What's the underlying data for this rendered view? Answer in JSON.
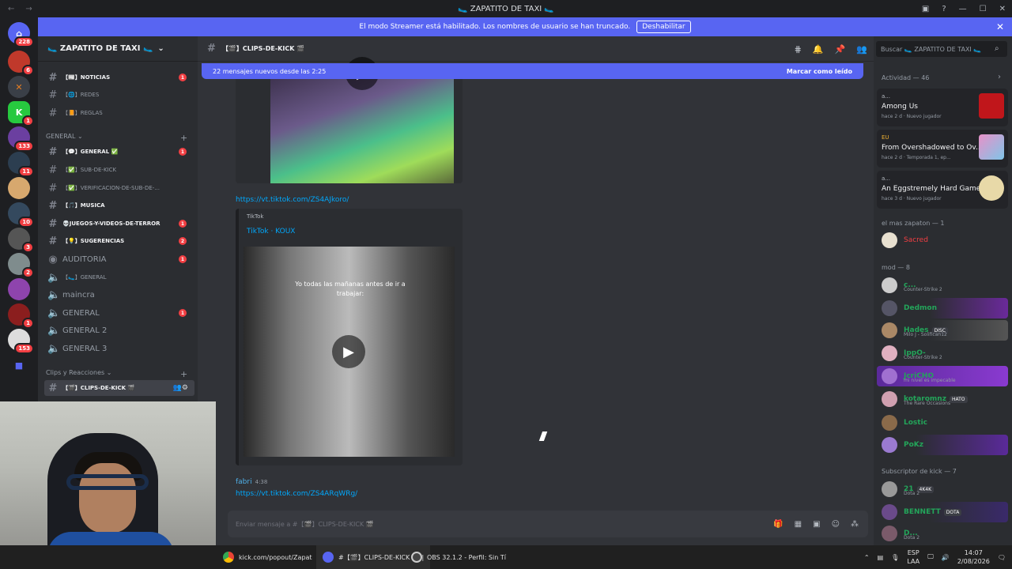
{
  "window": {
    "title": "🥿 ZAPATITO DE TAXI 🥿"
  },
  "banner": {
    "text": "El modo Streamer está habilitado. Los nombres de usuario se han truncado.",
    "button": "Deshabilitar"
  },
  "server": {
    "name": "🥿 ZAPATITO DE TAXI 🥿"
  },
  "channels": [
    {
      "label": "【📰】NOTICIAS",
      "badge": "1",
      "bold": true
    },
    {
      "label": "【🌐】REDES",
      "badge": "",
      "bold": false
    },
    {
      "label": "【📙】REGLAS",
      "badge": "",
      "bold": false
    },
    {
      "label": "【💬】GENERAL ✅",
      "badge": "1",
      "bold": true
    },
    {
      "label": "【✅】SUB-DE-KICK",
      "badge": "",
      "bold": false
    },
    {
      "label": "【✅】VERIFICACION-DE-SUB-DE-...",
      "badge": "",
      "bold": false
    },
    {
      "label": "【🎵】MUSICA",
      "badge": "",
      "bold": true
    },
    {
      "label": "💀JUEGOS-Y-VIDEOS-DE-TERROR",
      "badge": "1",
      "bold": true
    },
    {
      "label": "【💡】SUGERENCIAS",
      "badge": "2",
      "bold": true
    },
    {
      "label": "AUDITORIA",
      "badge": "1",
      "bold": false
    },
    {
      "label": "【🥿】GENERAL",
      "badge": "",
      "bold": false
    },
    {
      "label": "maincra",
      "badge": "",
      "bold": false
    },
    {
      "label": "GENERAL",
      "badge": "1",
      "bold": false
    },
    {
      "label": "GENERAL 2",
      "badge": "",
      "bold": false
    },
    {
      "label": "GENERAL 3",
      "badge": "",
      "bold": false
    },
    {
      "label": "【🎬】CLIPS-DE-KICK 🎬",
      "badge": "",
      "bold": true
    }
  ],
  "categories": {
    "general": "GENERAL",
    "clips": "Clips y Reacciones"
  },
  "server_badges": [
    "228",
    "6",
    "",
    "1",
    "133",
    "11",
    "",
    "10",
    "3",
    "2",
    "",
    "1",
    "153"
  ],
  "chat": {
    "channel_name": "【🎬】CLIPS-DE-KICK 🎬",
    "new_messages": "22 mensajes nuevos desde las 2:25",
    "mark_read": "Marcar como leído",
    "link1": "https://vt.tiktok.com/ZS4AJkoro/",
    "embed_provider": "TikTok",
    "embed_title": "TikTok · KOUX",
    "video_caption": "Yo todas las mañanas antes de ir a trabajar:",
    "author": "fabri",
    "time": "4:38",
    "link2": "https://vt.tiktok.com/ZS4ARqWRg/",
    "placeholder": "Enviar mensaje a #【🎬】CLIPS-DE-KICK 🎬"
  },
  "search": {
    "placeholder": "Buscar 🥿 ZAPATITO DE TAXI 🥿"
  },
  "activity": {
    "header": "Actividad — 46",
    "items": [
      {
        "who": "a...",
        "game": "Among Us",
        "meta": "hace 2 d · Nuevo jugador"
      },
      {
        "who": "EU",
        "game": "From Overshadowed to Ov...",
        "meta": "hace 2 d · Temporada 1, ep..."
      },
      {
        "who": "a...",
        "game": "An Eggstremely Hard Game",
        "meta": "hace 3 d · Nuevo jugador"
      }
    ]
  },
  "member_groups": {
    "zapaton": "el mas zapaton — 1",
    "mod": "mod — 8",
    "subs": "Subscriptor de kick — 7"
  },
  "members": [
    {
      "name": "Sacred",
      "status": "",
      "tag": "",
      "color": "#f23f43"
    },
    {
      "name": "c...",
      "status": "Counter-Strike 2",
      "tag": "",
      "color": "#23a55a"
    },
    {
      "name": "Dedmon",
      "status": "",
      "tag": "",
      "color": "#23a55a"
    },
    {
      "name": "Hades",
      "status": "Milo J - Solifican12",
      "tag": "DISC",
      "color": "#23a55a"
    },
    {
      "name": "IppO-",
      "status": "Counter-Strike 2",
      "tag": "",
      "color": "#23a55a"
    },
    {
      "name": "JcriCHO",
      "status": "mi nivel es impecable",
      "tag": "",
      "color": "#23a55a"
    },
    {
      "name": "kotaromnz",
      "status": "The Rare Occasions",
      "tag": "HATO",
      "color": "#23a55a"
    },
    {
      "name": "Lostic",
      "status": "",
      "tag": "",
      "color": "#23a55a"
    },
    {
      "name": "PoKz",
      "status": "",
      "tag": "",
      "color": "#23a55a"
    },
    {
      "name": "21",
      "status": "Dota 2",
      "tag": "4K4K",
      "color": "#23a55a"
    },
    {
      "name": "BENNETT",
      "status": "",
      "tag": "DOTA",
      "color": "#23a55a"
    },
    {
      "name": "D...",
      "status": "Dota 2",
      "tag": "",
      "color": "#23a55a"
    }
  ],
  "taskbar": {
    "chrome": "kick.com/popout/Zapat",
    "discord": "#【🎬】CLIPS-DE-KICK 🎬 |",
    "obs": "OBS 32.1.2 - Perfil: Sin Tí",
    "lang": "ESP",
    "lang2": "LAA",
    "time": "14:07",
    "date": "2/08/2026"
  }
}
